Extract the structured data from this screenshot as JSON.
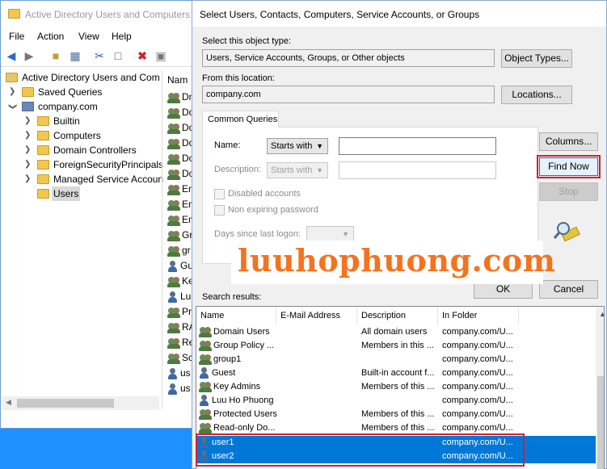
{
  "aduc": {
    "title": "Active Directory Users and Computers",
    "menu": [
      "File",
      "Action",
      "View",
      "Help"
    ],
    "tree": [
      {
        "label": "Active Directory Users and Com",
        "level": 0
      },
      {
        "label": "Saved Queries",
        "level": 1
      },
      {
        "label": "company.com",
        "level": 1
      },
      {
        "label": "Builtin",
        "level": 2
      },
      {
        "label": "Computers",
        "level": 2
      },
      {
        "label": "Domain Controllers",
        "level": 2
      },
      {
        "label": "ForeignSecurityPrincipals",
        "level": 2
      },
      {
        "label": "Managed Service Accoun",
        "level": 2
      },
      {
        "label": "Users",
        "level": 2,
        "selected": true
      }
    ],
    "list_header": "Nam",
    "list_items": [
      "Dn",
      "Do",
      "Do",
      "Do",
      "Do",
      "Do",
      "En",
      "En",
      "En",
      "Gr",
      "gr",
      "Gu",
      "Ke",
      "Lu",
      "Pr",
      "RA",
      "Re",
      "Sc",
      "us",
      "us"
    ]
  },
  "dialog": {
    "title": "Select Users, Contacts, Computers, Service Accounts, or Groups",
    "object_type_label": "Select this object type:",
    "object_type_value": "Users, Service Accounts, Groups, or Other objects",
    "object_types_button": "Object Types...",
    "location_label": "From this location:",
    "location_value": "company.com",
    "locations_button": "Locations...",
    "tab_label": "Common Queries",
    "name_label": "Name:",
    "name_mode": "Starts with",
    "description_label": "Description:",
    "description_mode": "Starts with",
    "disabled_accounts": "Disabled accounts",
    "non_expiring": "Non expiring password",
    "days_since_label": "Days since last logon:",
    "columns_button": "Columns...",
    "find_now_button": "Find Now",
    "stop_button": "Stop",
    "ok_button": "OK",
    "cancel_button": "Cancel",
    "search_results_label": "Search results:",
    "columns": [
      "Name",
      "E-Mail Address",
      "Description",
      "In Folder"
    ],
    "rows": [
      {
        "name": "Domain Users",
        "email": "",
        "description": "All domain users",
        "folder": "company.com/U...",
        "type": "group",
        "selected": false
      },
      {
        "name": "Group Policy ...",
        "email": "",
        "description": "Members in this ...",
        "folder": "company.com/U...",
        "type": "group",
        "selected": false
      },
      {
        "name": "group1",
        "email": "",
        "description": "",
        "folder": "company.com/U...",
        "type": "group",
        "selected": false
      },
      {
        "name": "Guest",
        "email": "",
        "description": "Built-in account f...",
        "folder": "company.com/U...",
        "type": "user",
        "selected": false
      },
      {
        "name": "Key Admins",
        "email": "",
        "description": "Members of this ...",
        "folder": "company.com/U...",
        "type": "group",
        "selected": false
      },
      {
        "name": "Luu Ho Phuong",
        "email": "",
        "description": "",
        "folder": "company.com/U...",
        "type": "user",
        "selected": false
      },
      {
        "name": "Protected Users",
        "email": "",
        "description": "Members of this ...",
        "folder": "company.com/U...",
        "type": "group",
        "selected": false
      },
      {
        "name": "Read-only Do...",
        "email": "",
        "description": "Members of this ...",
        "folder": "company.com/U...",
        "type": "group",
        "selected": false
      },
      {
        "name": "user1",
        "email": "",
        "description": "",
        "folder": "company.com/U...",
        "type": "user",
        "selected": true
      },
      {
        "name": "user2",
        "email": "",
        "description": "",
        "folder": "company.com/U...",
        "type": "user",
        "selected": true
      }
    ]
  },
  "watermark": "luuhophuong.com",
  "colors": {
    "highlight": "#d3202f",
    "selection": "#0078d7",
    "watermark": "#f4731e"
  }
}
